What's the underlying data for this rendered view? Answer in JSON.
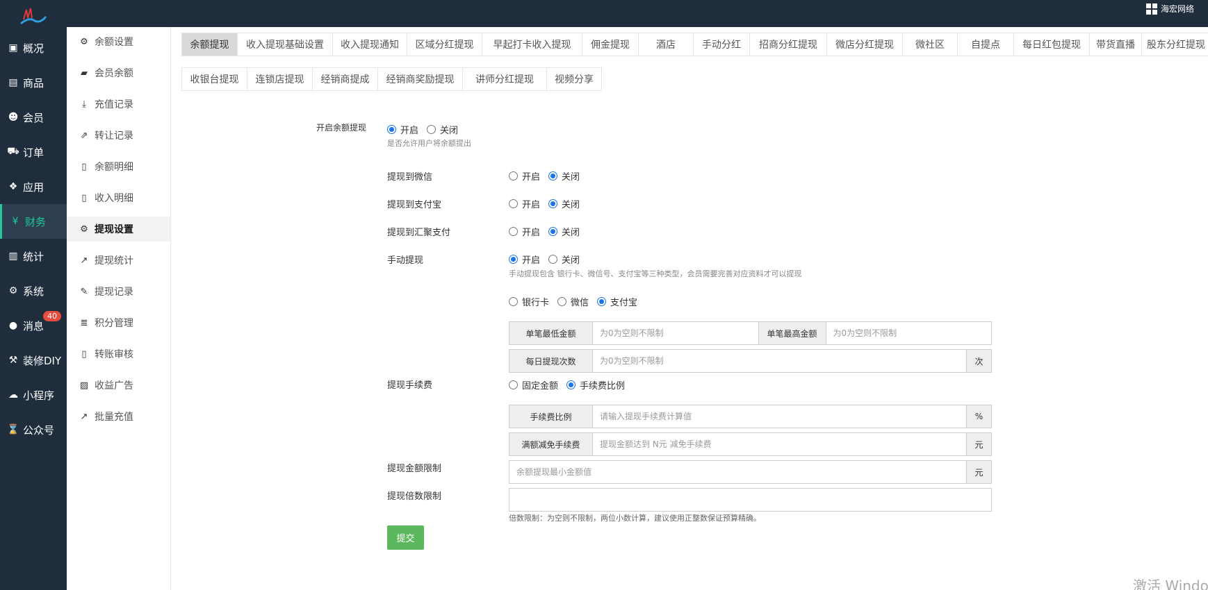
{
  "header": {
    "brand_name": "海宏网络"
  },
  "main_nav": [
    {
      "label": "概况",
      "icon": "monitor-icon",
      "glyph": "▣",
      "active": false
    },
    {
      "label": "商品",
      "icon": "box-icon",
      "glyph": "▤",
      "active": false
    },
    {
      "label": "会员",
      "icon": "users-icon",
      "glyph": "☻",
      "active": false
    },
    {
      "label": "订单",
      "icon": "cart-icon",
      "glyph": "⛟",
      "active": false
    },
    {
      "label": "应用",
      "icon": "apps-icon",
      "glyph": "❖",
      "active": false
    },
    {
      "label": "财务",
      "icon": "yen-icon",
      "glyph": "¥",
      "active": true
    },
    {
      "label": "统计",
      "icon": "bar-chart-icon",
      "glyph": "▥",
      "active": false
    },
    {
      "label": "系统",
      "icon": "cogs-icon",
      "glyph": "⚙",
      "active": false
    },
    {
      "label": "消息",
      "icon": "chat-icon",
      "glyph": "●",
      "active": false,
      "badge": "40"
    },
    {
      "label": "装修DIY",
      "icon": "gavel-icon",
      "glyph": "⚒",
      "active": false
    },
    {
      "label": "小程序",
      "icon": "wechat-icon",
      "glyph": "☁",
      "active": false
    },
    {
      "label": "公众号",
      "icon": "hourglass-icon",
      "glyph": "⌛",
      "active": false
    }
  ],
  "sub_nav": [
    {
      "label": "余额设置",
      "icon": "gear-icon",
      "glyph": "⚙",
      "active": false
    },
    {
      "label": "会员余额",
      "icon": "book-icon",
      "glyph": "▰",
      "active": false
    },
    {
      "label": "充值记录",
      "icon": "download-icon",
      "glyph": "⤓",
      "active": false
    },
    {
      "label": "转让记录",
      "icon": "external-link-icon",
      "glyph": "⇗",
      "active": false
    },
    {
      "label": "余额明细",
      "icon": "file-icon",
      "glyph": "▯",
      "active": false
    },
    {
      "label": "收入明细",
      "icon": "file-icon",
      "glyph": "▯",
      "active": false
    },
    {
      "label": "提现设置",
      "icon": "gear-icon",
      "glyph": "⚙",
      "active": true
    },
    {
      "label": "提现统计",
      "icon": "line-chart-icon",
      "glyph": "↗",
      "active": false
    },
    {
      "label": "提现记录",
      "icon": "pencil-icon",
      "glyph": "✎",
      "active": false
    },
    {
      "label": "积分管理",
      "icon": "database-icon",
      "glyph": "≣",
      "active": false
    },
    {
      "label": "转账审核",
      "icon": "file-icon",
      "glyph": "▯",
      "active": false
    },
    {
      "label": "收益广告",
      "icon": "image-icon",
      "glyph": "▨",
      "active": false
    },
    {
      "label": "批量充值",
      "icon": "line-chart-icon",
      "glyph": "↗",
      "active": false
    }
  ],
  "tabs_row1": [
    "余额提现",
    "收入提现基础设置",
    "收入提现通知",
    "区域分红提现",
    "早起打卡收入提现",
    "佣金提现",
    "酒店",
    "手动分红",
    "招商分红提现",
    "微店分红提现",
    "微社区",
    "自提点",
    "每日红包提现",
    "带货直播",
    "股东分红提现"
  ],
  "tabs_row2": [
    "收银台提现",
    "连锁店提现",
    "经销商提成",
    "经销商奖励提现",
    "讲师分红提现",
    "视频分享"
  ],
  "active_tab": "余额提现",
  "form": {
    "enable_balance": {
      "label": "开启余额提现",
      "on": "开启",
      "off": "关闭",
      "value": "on",
      "help": "是否允许用户将余额提出"
    },
    "to_wechat": {
      "label": "提现到微信",
      "on": "开启",
      "off": "关闭",
      "value": "off"
    },
    "to_alipay": {
      "label": "提现到支付宝",
      "on": "开启",
      "off": "关闭",
      "value": "off"
    },
    "to_huiju": {
      "label": "提现到汇聚支付",
      "on": "开启",
      "off": "关闭",
      "value": "off"
    },
    "manual": {
      "label": "手动提现",
      "on": "开启",
      "off": "关闭",
      "value": "on",
      "help": "手动提现包含 银行卡、微信号、支付宝等三种类型，会员需要完善对应资料才可以提现"
    },
    "manual_types": {
      "bank": "银行卡",
      "wechat": "微信",
      "alipay": "支付宝",
      "value": "alipay"
    },
    "min_amount": {
      "label": "单笔最低金额",
      "placeholder": "为0为空则不限制"
    },
    "max_amount": {
      "label": "单笔最高金额",
      "placeholder": "为0为空则不限制"
    },
    "daily_count": {
      "label": "每日提现次数",
      "placeholder": "为0为空则不限制",
      "unit": "次"
    },
    "fee": {
      "label": "提现手续费",
      "fixed": "固定金额",
      "ratio": "手续费比例",
      "value": "ratio"
    },
    "fee_ratio": {
      "label": "手续费比例",
      "placeholder": "请输入提现手续费计算值",
      "unit": "%"
    },
    "fee_free": {
      "label": "满额减免手续费",
      "placeholder": "提现金额达到 N元 减免手续费",
      "unit": "元"
    },
    "amount_limit": {
      "label": "提现金额限制",
      "placeholder": "余额提现最小金额值",
      "unit": "元"
    },
    "multiple_limit": {
      "label": "提现倍数限制",
      "value": "",
      "help": "倍数限制：为空则不限制，两位小数计算，建议使用正整数保证预算精确。"
    },
    "submit_label": "提交"
  },
  "watermark": "激活 Windo",
  "colors": {
    "sidebar_bg": "#1f2d3d",
    "accent": "#20c997",
    "badge": "#e74c3c",
    "submit": "#5cb85c",
    "radio": "#1a73e8"
  }
}
